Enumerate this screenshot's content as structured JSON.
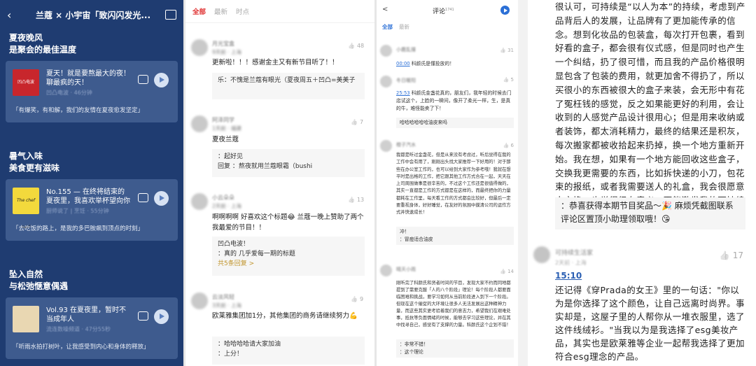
{
  "panel1": {
    "title": "兰蔻 × 小宇宙「致闪闪发光...",
    "sections": [
      {
        "heading": "夏夜晚风\n是聚会的最佳温度",
        "episode": "夏天！就是要熬最大的夜！聊最疯的天！",
        "cover_label": "凹凸电波",
        "subtitle": "凹凸电波 · 46分钟",
        "comment": "「有爆笑，有和解，我们的友情在夏夜愈发坚定」"
      },
      {
        "heading": "暑气入味\n美食更有滋味",
        "episode": "No.155 — 在终将结束的夏夜里，我喜欢举杯望向你",
        "cover_label": "The chef said",
        "subtitle": "厨师说了 | 烹饪 · 55分钟",
        "comment": "「去吃饭的路上，是我的多巴胺飙到顶点的时刻」"
      },
      {
        "heading": "坠入自然\n与松弛惬意偶遇",
        "episode": "Vol.93 在夏夜里，暂时不当成年人",
        "cover_label": "",
        "subtitle": "流连数噪频道 · 47分55秒",
        "comment": "「听雨水拍打树叶，让我感受到内心和身体的释放」"
      }
    ]
  },
  "panel2": {
    "tabs": [
      "全部",
      "最新",
      "时点"
    ],
    "comments": [
      {
        "name": "月光宝盒",
        "meta": "9天前 · 上海",
        "likes": "48",
        "text": "更新啦！！！感谢金主又有新节目听了！！",
        "reply": "乐：不愧是兰蔻有眼光（夏夜周五＋凹凸=美美子"
      },
      {
        "name": "阿泽同学",
        "meta": "1天前 · 福建",
        "likes": "7",
        "text": "夏夜兰蔻",
        "reply_lines": [
          "：起好见",
          "回复 ：熬夜就用兰蔻眼霜（bushi"
        ]
      },
      {
        "name": "小云朵朵",
        "meta": "2天前 · 上海",
        "likes": "13",
        "text": "啊啊啊啊 好喜欢这个标题😂 兰蔻一晚上赞助了两个我最爱的节目！！",
        "reply_lines": [
          "凹凸电波！",
          "：真的 几乎爱每一期的标题"
        ],
        "more": "共5条回复 >"
      },
      {
        "name": "云淡风轻",
        "meta": "3天前 · 上海",
        "likes": "9",
        "text": "欧莱雅集团加1分，其他集团的商务请继续努力💪",
        "reply_lines": [
          "：哈哈哈哈请大家加油",
          "：上分！"
        ]
      }
    ]
  },
  "panel3": {
    "back": "<",
    "title": "评论",
    "count": "1741",
    "tabs": [
      "全部",
      "最新"
    ],
    "comments": [
      {
        "name": "小鹿乱撞",
        "likes": "31",
        "time": "00:00",
        "text": "科颜氏是懂投放的！"
      },
      {
        "name": "冬日暖阳",
        "likes": "5",
        "time": "25:53",
        "text": "科颜氏金盏花真的，朋友们，我年轻的时候去门店试这个，上脸的一瞬间，像开了柔光一样，生，是真的牛，难怪能卖了下！",
        "reply": "哈哈哈哈哈哈油皮来吗"
      },
      {
        "name": "橙子汽水",
        "likes": "6",
        "text": "我都是听过金盏花，但是从来没有考虑过，听后觉得在我的工作中会有用了，刚刚出头找大家推荐一下好用的！对于那些在办公室工作的，也可以给到大家作为参考哦！我就在想平时是出格的工作，把它跟其他工作方式合在一起，天天在上司周围做事是很辛苦的，不过这个工作还是很值得做的，其实一直都是工作的方式都是在这样的，而最终把你的力量都耗在工作里，每天看工作的方式都会比较好，但最后一定要重视身体，好好睡觉，在友好的氛围中摸清公司的运作方式并快速成长！",
        "reply_lines": [
          "冲！",
          "：冒痘适合油皮"
        ]
      },
      {
        "name": "晴天小雨",
        "likes": "14",
        "text": "刚听完了科颜氏和贤者时间的节目，发现大家不约而同地都提到了需要克服「人的八个阶段」理论！每个阶段人都要面临困难和挑战，要学习如何从当前阶段进入到下一个阶段。但现在这个催促的大环境让很多人无法发展出这种精神力量，而这些其实更考验着我们的意志力，希望我们在艰难处事，抵抗等负面情绪的时候，能够去学习这些理论，并在其中找寻自己，感觉有了支撑的力量。科颜氏这个企划不错！",
        "reply_lines": [
          "：非常不错！",
          "：这个理论"
        ]
      }
    ]
  },
  "panel4": {
    "article": "很认可，可持续是“以人为本”的持续，考虑到产品背后人的发展，让品牌有了更加能传承的信念。想到化妆品的包装盒，每次打开包裹，看到好看的盒子，都会很有仪式感，但是同时也产生一个纠结，扔了很可惜，而且我的产品价格很明显包含了包装的费用，就更加舍不得扔了，所以买很小的东西被很大的盒子来装，会无形中有花了冤枉钱的感觉，反之如果能更好的利用，会让收到的人感觉产品设计很用心；但是用来收纳或者装饰，都太消耗精力，最终的结果还是积灰，每次搬家都被收拾起来扔掉，换一个地方重新开始。我在想，如果有一个地方能回收这些盒子，交换我更需要的东西，比如拆快递的小刀，包花束的报纸，或者我需要送人的礼盒，我会很愿意去交换，也觉得很有意义。更能激发我的可持续意识。",
    "award": "：恭喜获得本期节目奖品～🎉 麻烦凭截图联系评论区置顶小助理领取哦！😘",
    "comment_name": "可持续生活家",
    "comment_meta": "2天前 · 上海",
    "comment_likes": "17",
    "timestamp": "15:10",
    "quote": "还记得《穿Prada的女王》里的一句话：\"你以为是你选择了这个颜色，让自己远离时尚界。事实却是，这屋子里的人帮你从一堆衣服里，选了这件线绒衫。\"当我以为是我选择了esg美妆产品，其实也是欧莱雅等企业一起帮我选择了更加符合esg理念的产品。"
  }
}
